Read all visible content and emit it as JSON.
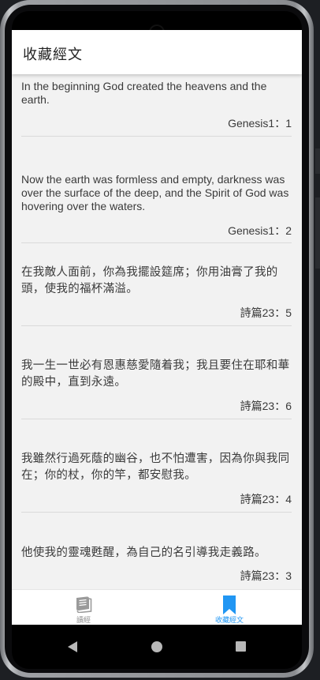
{
  "app": {
    "title": "收藏經文"
  },
  "favorites": [
    {
      "text": "In the beginning God created the heavens and the earth.",
      "ref": "Genesis1：1"
    },
    {
      "text": "Now the earth was formless and empty, darkness was over the surface of the deep, and the Spirit of God was hovering over the waters.",
      "ref": "Genesis1：2"
    },
    {
      "text": "在我敵人面前，你為我擺設筵席；你用油膏了我的頭，使我的福杯滿溢。",
      "ref": "詩篇23：5"
    },
    {
      "text": "我一生一世必有恩惠慈愛隨着我；我且要住在耶和華的殿中，直到永遠。",
      "ref": "詩篇23：6"
    },
    {
      "text": "我雖然行過死蔭的幽谷，也不怕遭害，因為你與我同在；你的杖，你的竿，都安慰我。",
      "ref": "詩篇23：4"
    },
    {
      "text": "他使我的靈魂甦醒，為自己的名引導我走義路。",
      "ref": "詩篇23：3"
    }
  ],
  "bottom_nav": {
    "items": [
      {
        "label": "讀經",
        "icon": "book-icon",
        "active": false
      },
      {
        "label": "收藏經文",
        "icon": "bookmark-icon",
        "active": true
      }
    ]
  },
  "colors": {
    "accent": "#2196f3",
    "content_bg": "#f2f2f2",
    "inactive": "#8c8c8c"
  }
}
